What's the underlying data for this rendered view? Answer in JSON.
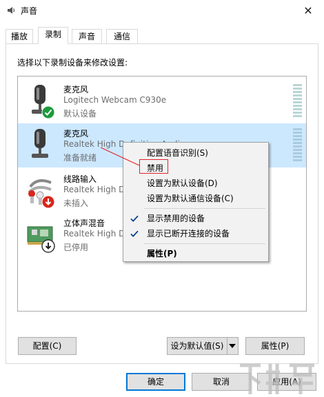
{
  "window": {
    "title": "声音",
    "close_glyph": "✕"
  },
  "tabs": [
    {
      "label": "播放",
      "active": false
    },
    {
      "label": "录制",
      "active": true
    },
    {
      "label": "声音",
      "active": false
    },
    {
      "label": "通信",
      "active": false
    }
  ],
  "instruction": "选择以下录制设备来修改设置:",
  "devices": [
    {
      "name": "麦克风",
      "desc": "Logitech Webcam C930e",
      "status": "默认设备",
      "icon": "webcam-mic-icon",
      "badge": "default-check-icon",
      "selected": false
    },
    {
      "name": "麦克风",
      "desc": "Realtek High Definition Audio",
      "status": "准备就绪",
      "icon": "microphone-icon",
      "badge": "",
      "selected": true
    },
    {
      "name": "线路输入",
      "desc": "Realtek High Definition Audio",
      "status": "未插入",
      "icon": "line-in-icon",
      "badge": "unplugged-icon",
      "selected": false
    },
    {
      "name": "立体声混音",
      "desc": "Realtek High Definition Audio",
      "status": "已停用",
      "icon": "stereo-mix-icon",
      "badge": "disabled-icon",
      "selected": false
    }
  ],
  "context_menu": {
    "items": [
      {
        "label": "配置语音识别(S)",
        "checked": false,
        "bold": false
      },
      {
        "label": "禁用",
        "checked": false,
        "bold": false
      },
      {
        "label": "设置为默认设备(D)",
        "checked": false,
        "bold": false
      },
      {
        "label": "设置为默认通信设备(C)",
        "checked": false,
        "bold": false
      },
      {
        "label": "显示禁用的设备",
        "checked": true,
        "bold": false
      },
      {
        "label": "显示已断开连接的设备",
        "checked": true,
        "bold": false
      },
      {
        "label": "属性(P)",
        "checked": false,
        "bold": true
      }
    ]
  },
  "buttons": {
    "configure": "配置(C)",
    "set_default": "设为默认值(S)",
    "properties": "属性(P)",
    "ok": "确定",
    "cancel": "取消",
    "apply": "应用(A)"
  },
  "colors": {
    "selection": "#cce8ff",
    "accent": "#0078d7",
    "check_green": "#1d9a3c",
    "badge_red": "#d9261c",
    "annotation_red": "#e0242b"
  }
}
